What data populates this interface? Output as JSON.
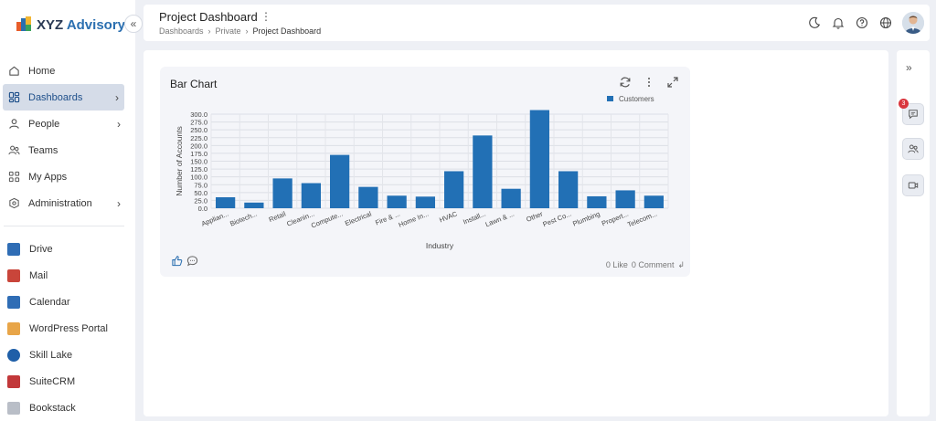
{
  "brand": {
    "name_part1": "XYZ",
    "name_part2": "Advisory"
  },
  "sidebar": {
    "nav": [
      {
        "label": "Home",
        "icon": "home-icon"
      },
      {
        "label": "Dashboards",
        "icon": "dashboard-icon",
        "active": true
      },
      {
        "label": "People",
        "icon": "person-icon"
      },
      {
        "label": "Teams",
        "icon": "teams-icon"
      },
      {
        "label": "My Apps",
        "icon": "apps-icon"
      },
      {
        "label": "Administration",
        "icon": "admin-icon"
      }
    ],
    "apps": [
      {
        "label": "Drive",
        "icon": "drive-icon",
        "color": "#2f6db5"
      },
      {
        "label": "Mail",
        "icon": "mail-icon",
        "color": "#c9453a"
      },
      {
        "label": "Calendar",
        "icon": "calendar-icon",
        "color": "#2f6db5"
      },
      {
        "label": "WordPress Portal",
        "icon": "wordpress-icon",
        "color": "#e8a548"
      },
      {
        "label": "Skill Lake",
        "icon": "skill-lake-icon",
        "color": "#1f5fa8"
      },
      {
        "label": "SuiteCRM",
        "icon": "suitecrm-icon",
        "color": "#c2383a"
      },
      {
        "label": "Bookstack",
        "icon": "bookstack-icon",
        "color": "#b9bec7"
      }
    ]
  },
  "header": {
    "title": "Project Dashboard",
    "breadcrumb": [
      "Dashboards",
      "Private",
      "Project Dashboard"
    ]
  },
  "widget": {
    "title": "Bar Chart",
    "likes": "0 Like",
    "comments": "0 Comment"
  },
  "right_panel": {
    "badge": "3"
  },
  "chart_data": {
    "type": "bar",
    "xlabel": "Industry",
    "ylabel": "Number of Accounts",
    "ylim": [
      0,
      300
    ],
    "yticks": [
      "0.0",
      "25.0",
      "50.0",
      "75.0",
      "100.0",
      "125.0",
      "150.0",
      "175.0",
      "200.0",
      "225.0",
      "250.0",
      "275.0",
      "300.0"
    ],
    "grid": true,
    "legend_position": "top-right",
    "categories": [
      "Applian...",
      "Biotech...",
      "Retail",
      "Cleanin...",
      "Compute...",
      "Electrical",
      "Fire & ...",
      "Home In...",
      "HVAC",
      "Install...",
      "Lawn & ...",
      "Other",
      "Pest Co...",
      "Plumbing",
      "Propert...",
      "Telecom..."
    ],
    "series": [
      {
        "name": "Customers",
        "color": "#2270b5",
        "values": [
          35,
          18,
          95,
          80,
          170,
          68,
          40,
          37,
          118,
          232,
          62,
          313,
          118,
          38,
          57,
          40
        ]
      }
    ]
  }
}
